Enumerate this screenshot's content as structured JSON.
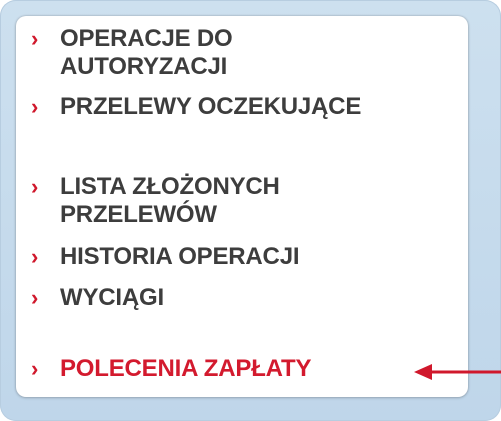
{
  "menu": {
    "items": [
      {
        "label": "OPERACJE DO AUTORYZACJI",
        "lines": [
          "OPERACJE DO",
          "AUTORYZACJI"
        ],
        "active": false
      },
      {
        "label": "PRZELEWY OCZEKUJĄCE",
        "lines": [
          "PRZELEWY OCZEKUJĄCE"
        ],
        "active": false
      },
      {
        "label": "LISTA ZŁOŻONYCH PRZELEWÓW",
        "lines": [
          "LISTA ZŁOŻONYCH",
          "PRZELEWÓW"
        ],
        "active": false
      },
      {
        "label": "HISTORIA OPERACJI",
        "lines": [
          "HISTORIA OPERACJI"
        ],
        "active": false
      },
      {
        "label": "WYCIĄGI",
        "lines": [
          "WYCIĄGI"
        ],
        "active": false
      },
      {
        "label": "POLECENIA ZAPŁATY",
        "lines": [
          "POLECENIA ZAPŁATY"
        ],
        "active": true
      }
    ],
    "chevron": "›"
  },
  "colors": {
    "accent": "#d31a2e",
    "text": "#3d3d3d",
    "frame": "#c6dbed",
    "panel": "#ffffff"
  },
  "icons": {
    "bullet": "chevron-right-icon",
    "pointer": "red-arrow-left-icon"
  }
}
